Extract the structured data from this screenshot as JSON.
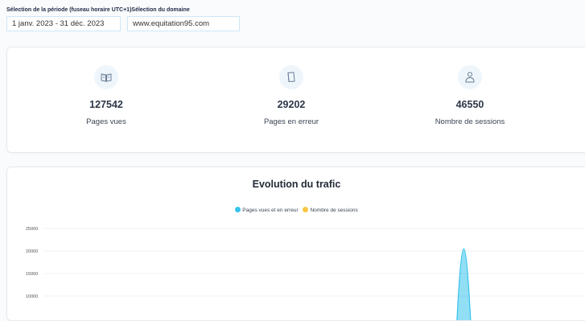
{
  "filters": {
    "period_label": "Sélection de la période (fuseau horaire UTC+1)",
    "domain_label": "Sélection du domaine",
    "period_value": "1 janv. 2023 - 31 déc. 2023",
    "domain_value": "www.equitation95.com"
  },
  "kpis": [
    {
      "icon": "book-open-icon",
      "value": "127542",
      "label": "Pages vues"
    },
    {
      "icon": "book-error-icon",
      "value": "29202",
      "label": "Pages en erreur"
    },
    {
      "icon": "user-icon",
      "value": "46550",
      "label": "Nombre de sessions"
    }
  ],
  "colors": {
    "series_pages": "#36c3ec",
    "series_sessions": "#f7c744",
    "accent_icon": "#6b7c93"
  },
  "chart_data": {
    "type": "area",
    "title": "Evolution du trafic",
    "legend_position": "top-center",
    "grid": true,
    "ylim": [
      0,
      25000
    ],
    "yticks": [
      25000,
      20000,
      15000,
      10000
    ],
    "series": [
      {
        "name": "Pages vues et en erreur",
        "color": "#36c3ec",
        "peak_x_fraction": 0.775,
        "peak_value": 20500
      }
    ],
    "legend": [
      {
        "name": "Pages vues et en erreur",
        "color": "#36c3ec"
      },
      {
        "name": "Nombre de sessions",
        "color": "#f7c744"
      }
    ]
  }
}
